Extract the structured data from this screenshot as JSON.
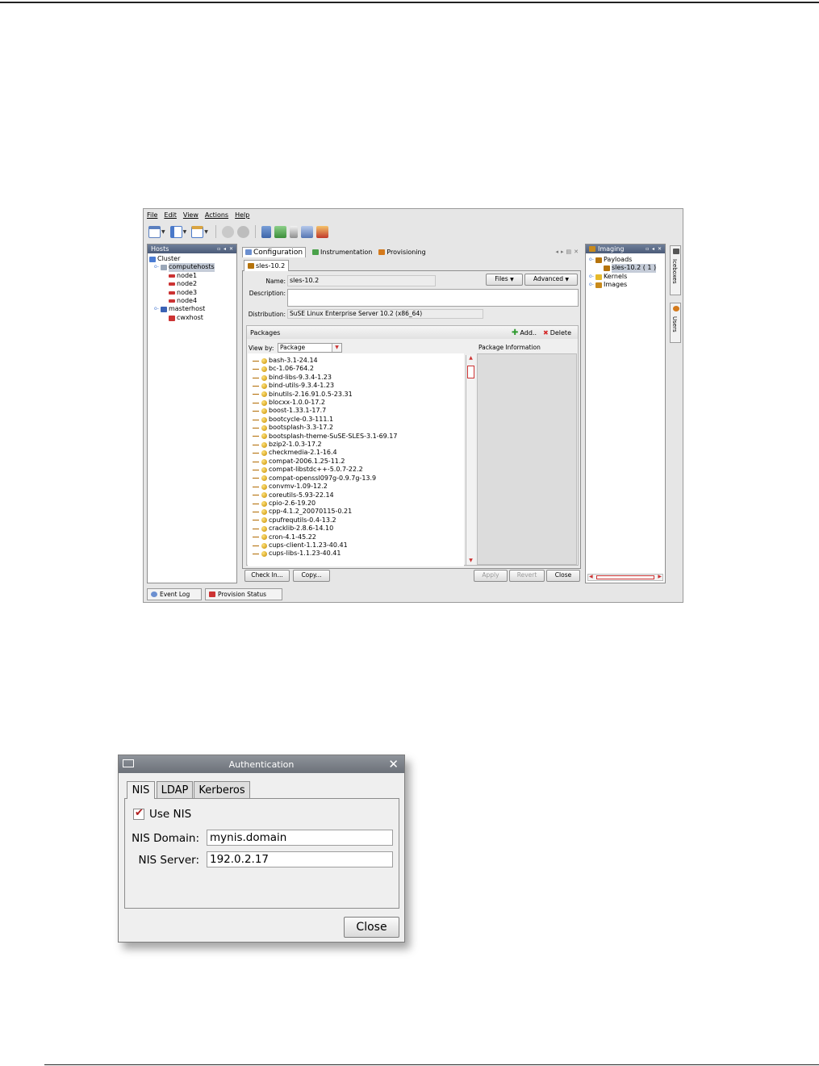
{
  "menu": [
    "File",
    "Edit",
    "View",
    "Actions",
    "Help"
  ],
  "hosts_panel": {
    "title": "Hosts",
    "tree": [
      {
        "label": "Cluster",
        "level": 0
      },
      {
        "label": "computehosts",
        "level": 1
      },
      {
        "label": "node1",
        "level": 2
      },
      {
        "label": "node2",
        "level": 2
      },
      {
        "label": "node3",
        "level": 2
      },
      {
        "label": "node4",
        "level": 2
      },
      {
        "label": "masterhost",
        "level": 1
      },
      {
        "label": "cwxhost",
        "level": 2
      }
    ]
  },
  "main_tabs": [
    "Configuration",
    "Instrumentation",
    "Provisioning"
  ],
  "subtab": "sles-10.2",
  "form": {
    "name_label": "Name:",
    "name_value": "sles-10.2",
    "description_label": "Description:",
    "description_value": "",
    "distribution_label": "Distribution:",
    "distribution_value": "SuSE Linux Enterprise Server 10.2 (x86_64)",
    "files_button": "Files",
    "advanced_button": "Advanced"
  },
  "packages": {
    "title": "Packages",
    "add_label": "Add..",
    "delete_label": "Delete",
    "view_by_label": "View by:",
    "view_by_value": "Package",
    "info_header": "Package Information",
    "items": [
      "bash-3.1-24.14",
      "bc-1.06-764.2",
      "bind-libs-9.3.4-1.23",
      "bind-utils-9.3.4-1.23",
      "binutils-2.16.91.0.5-23.31",
      "blocxx-1.0.0-17.2",
      "boost-1.33.1-17.7",
      "bootcycle-0.3-111.1",
      "bootsplash-3.3-17.2",
      "bootsplash-theme-SuSE-SLES-3.1-69.17",
      "bzip2-1.0.3-17.2",
      "checkmedia-2.1-16.4",
      "compat-2006.1.25-11.2",
      "compat-libstdc++-5.0.7-22.2",
      "compat-openssl097g-0.9.7g-13.9",
      "convmv-1.09-12.2",
      "coreutils-5.93-22.14",
      "cpio-2.6-19.20",
      "cpp-4.1.2_20070115-0.21",
      "cpufrequtils-0.4-13.2",
      "cracklib-2.8.6-14.10",
      "cron-4.1-45.22",
      "cups-client-1.1.23-40.41",
      "cups-libs-1.1.23-40.41"
    ]
  },
  "bottom_buttons": {
    "check_in": "Check In...",
    "copy": "Copy...",
    "apply": "Apply",
    "revert": "Revert",
    "close": "Close"
  },
  "imaging_panel": {
    "title": "Imaging",
    "tree": [
      {
        "label": "Payloads",
        "level": 0
      },
      {
        "label": "sles-10.2 ( 1 )",
        "level": 1
      },
      {
        "label": "Kernels",
        "level": 0
      },
      {
        "label": "Images",
        "level": 0
      }
    ]
  },
  "side_tabs": [
    "Iceboxes",
    "Users"
  ],
  "status_tabs": [
    "Event Log",
    "Provision Status"
  ],
  "auth_dialog": {
    "title": "Authentication",
    "tabs": [
      "NIS",
      "LDAP",
      "Kerberos"
    ],
    "use_nis_label": "Use NIS",
    "use_nis_checked": true,
    "nis_domain_label": "NIS Domain:",
    "nis_domain_value": "mynis.domain",
    "nis_server_label": "NIS Server:",
    "nis_server_value": "192.0.2.17",
    "close_label": "Close"
  }
}
